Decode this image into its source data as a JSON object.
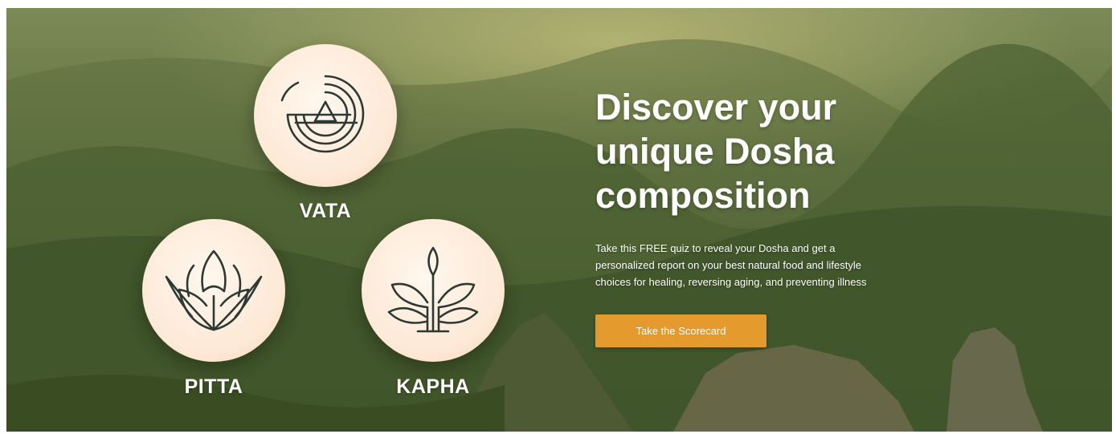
{
  "hero": {
    "headline_line1": "Discover your",
    "headline_line2": "unique Dosha",
    "headline_line3": "composition",
    "description": "Take this FREE quiz to reveal your Dosha and get a personalized report on your best natural food and lifestyle choices for healing, reversing aging, and preventing illness",
    "cta_label": "Take the Scorecard",
    "cta_color": "#e49a2d"
  },
  "doshas": [
    {
      "label": "VATA",
      "icon": "vata-air-spiral-icon"
    },
    {
      "label": "PITTA",
      "icon": "pitta-lotus-icon"
    },
    {
      "label": "KAPHA",
      "icon": "kapha-leaves-icon"
    }
  ],
  "colors": {
    "icon_stroke": "#2d3a34",
    "circle_fill": "#fdebd8",
    "text": "#ffffff"
  }
}
